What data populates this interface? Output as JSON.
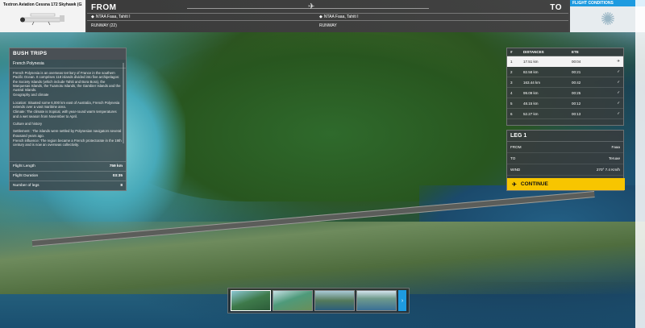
{
  "aircraft": {
    "name": "Textron Aviation Cessna 172 Skyhawk (G1"
  },
  "route": {
    "from_label": "FROM",
    "to_label": "TO",
    "from_airport": "NTAA Faaa, Tahiti I",
    "to_airport": "NTAA Faaa, Tahiti I",
    "from_runway": "RUNWAY (22)",
    "to_runway": "RUNWAY"
  },
  "flight_conditions": {
    "label": "FLIGHT CONDITIONS",
    "icon": "sun-icon"
  },
  "trip": {
    "title": "BUSH TRIPS",
    "subtitle": "French Polynesia",
    "paragraphs": [
      "French Polynesia is an overseas territory of France in the southern Pacific Ocean. It comprises 118 islands divided into five archipelagos: the Society Islands (which include Tahiti and Bora Bora), the Marquesas Islands, the Tuamotu Islands, the Gambier Islands and the Austral Islands.",
      "Geography and climate",
      "Location: Situated some 6,000 km east of Australia, French Polynesia extends over a vast maritime area.",
      "Climate: The climate is tropical, with year-round warm temperatures and a wet season from November to April.",
      "Culture and history",
      "Settlement : The islands were settled by Polynesian navigators several thousand years ago.",
      "French influence: The region became a French protectorate in the 19th century and is now an overseas collectivity."
    ],
    "stats": [
      {
        "label": "Flight Length",
        "value": "759 km"
      },
      {
        "label": "Flight Duration",
        "value": "03:35"
      },
      {
        "label": "Number of legs",
        "value": "8"
      }
    ]
  },
  "legs_table": {
    "headers": [
      "#",
      "DISTANCES",
      "ETE"
    ],
    "rows": [
      {
        "num": "1",
        "distance": "17.51 km",
        "ete": "00:04",
        "status": "plane-icon"
      },
      {
        "num": "2",
        "distance": "82.58 km",
        "ete": "00:21",
        "status": "check-icon"
      },
      {
        "num": "3",
        "distance": "163.44 km",
        "ete": "00:42",
        "status": "check-icon"
      },
      {
        "num": "4",
        "distance": "99.09 km",
        "ete": "00:25",
        "status": "check-icon"
      },
      {
        "num": "5",
        "distance": "48.15 km",
        "ete": "00:12",
        "status": "check-icon"
      },
      {
        "num": "6",
        "distance": "52.27 km",
        "ete": "00:13",
        "status": "check-icon"
      }
    ]
  },
  "leg_detail": {
    "title": "LEG 1",
    "from_label": "FROM",
    "from_value": "Faaa",
    "to_label": "TO",
    "to_value": "Teruae",
    "wind_label": "WIND",
    "wind_value": "270° 7.4 Km/h"
  },
  "continue_label": "CONTINUE",
  "colors": {
    "accent": "#1e9be0",
    "continue": "#f7c500"
  }
}
